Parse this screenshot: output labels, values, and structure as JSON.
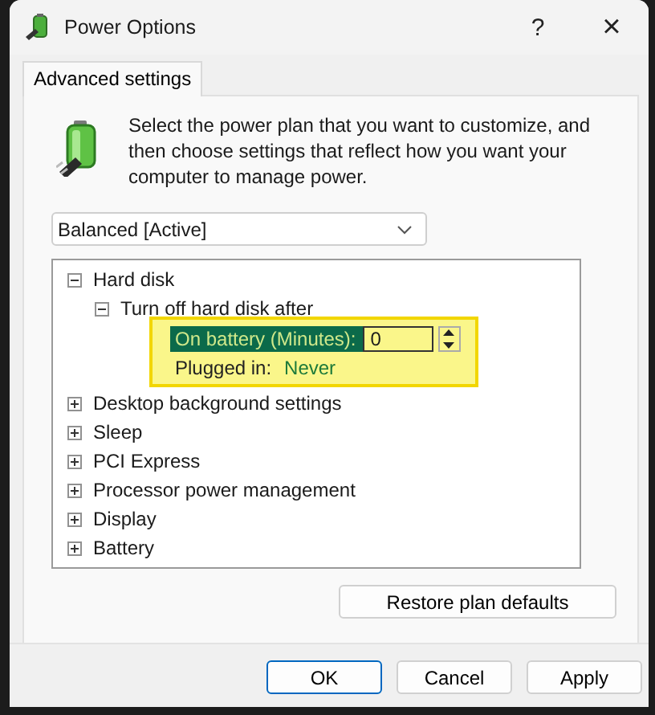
{
  "window": {
    "title": "Power Options",
    "help": "?",
    "close": "×"
  },
  "tabs": [
    {
      "label": "Advanced settings",
      "selected": true
    }
  ],
  "description": "Select the power plan that you want to customize, and then choose settings that reflect how you want your computer to manage power.",
  "plan_dropdown": {
    "value": "Balanced [Active]"
  },
  "tree": [
    {
      "label": "Hard disk",
      "expanded": true,
      "children": [
        {
          "label": "Turn off hard disk after",
          "expanded": true,
          "settings": [
            {
              "kind": "spin",
              "label": "On battery (Minutes):",
              "value": "0",
              "selected": true
            },
            {
              "kind": "text",
              "label": "Plugged in:",
              "value": "Never",
              "selected": false
            }
          ]
        }
      ]
    },
    {
      "label": "Desktop background settings",
      "expanded": false
    },
    {
      "label": "Sleep",
      "expanded": false
    },
    {
      "label": "PCI Express",
      "expanded": false
    },
    {
      "label": "Processor power management",
      "expanded": false
    },
    {
      "label": "Display",
      "expanded": false
    },
    {
      "label": "Battery",
      "expanded": false
    }
  ],
  "restore_button": "Restore plan defaults",
  "buttons": [
    {
      "label": "OK",
      "default": true
    },
    {
      "label": "Cancel",
      "default": false
    },
    {
      "label": "Apply",
      "default": false
    }
  ]
}
